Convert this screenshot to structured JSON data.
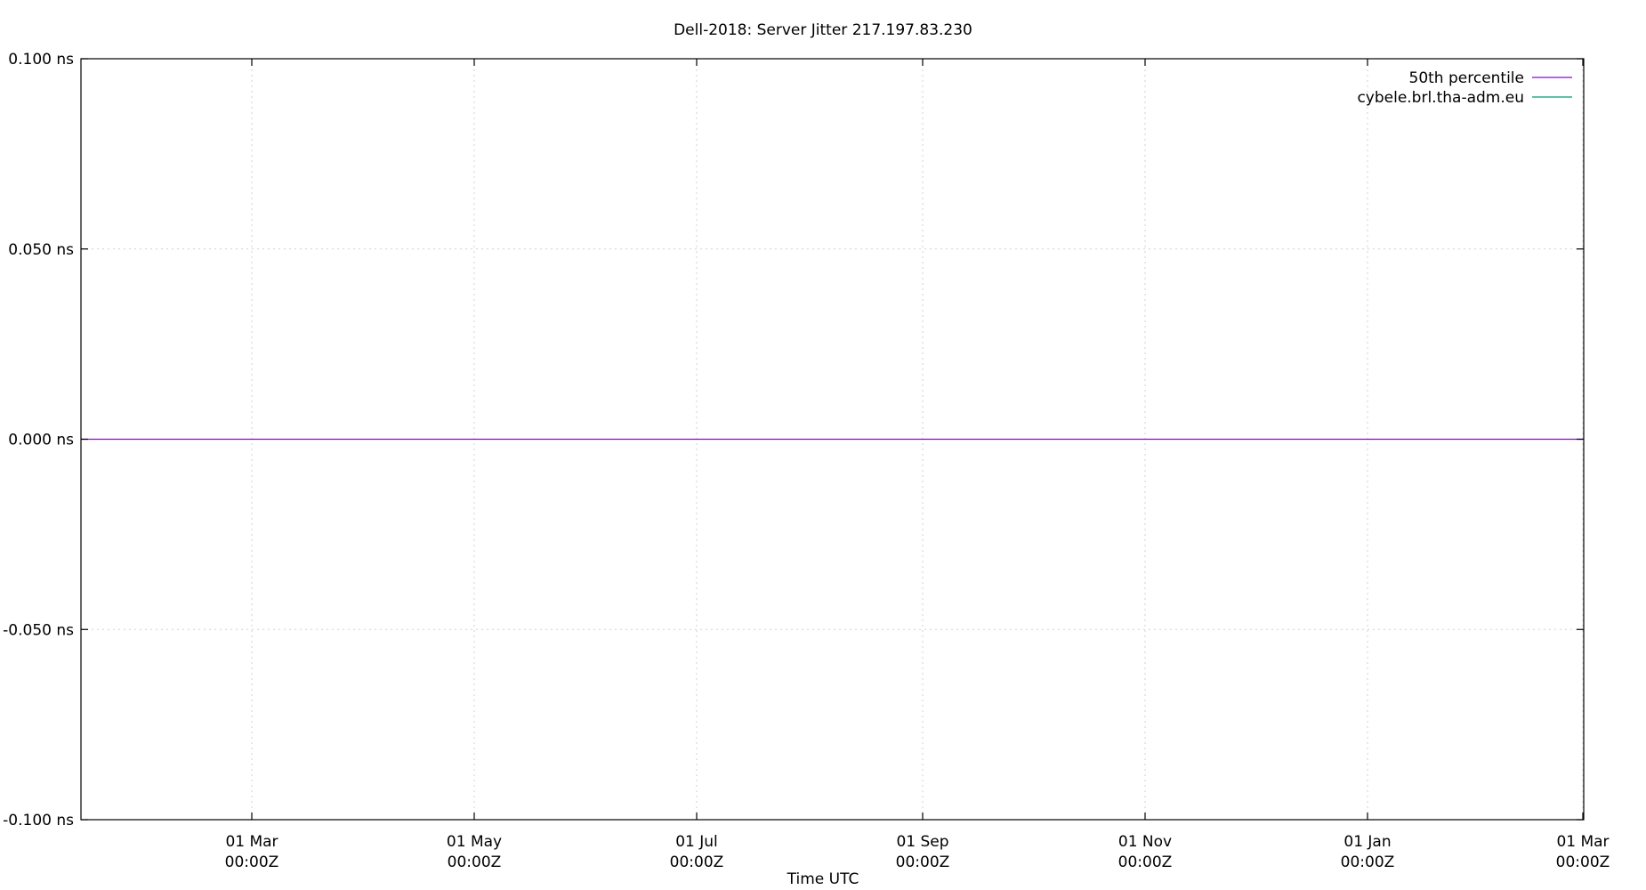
{
  "chart_data": {
    "type": "line",
    "title": "Dell-2018: Server Jitter 217.197.83.230",
    "xlabel": "Time UTC",
    "ylabel": "",
    "ylim": [
      -0.1,
      0.1
    ],
    "y_ticks": [
      {
        "value": 0.1,
        "label": "0.100 ns"
      },
      {
        "value": 0.05,
        "label": "0.050 ns"
      },
      {
        "value": 0.0,
        "label": "0.000 ns"
      },
      {
        "value": -0.05,
        "label": "-0.050 ns"
      },
      {
        "value": -0.1,
        "label": "-0.100 ns"
      }
    ],
    "x_ticks": [
      {
        "line1": "01 Mar",
        "line2": "00:00Z"
      },
      {
        "line1": "01 May",
        "line2": "00:00Z"
      },
      {
        "line1": "01 Jul",
        "line2": "00:00Z"
      },
      {
        "line1": "01 Sep",
        "line2": "00:00Z"
      },
      {
        "line1": "01 Nov",
        "line2": "00:00Z"
      },
      {
        "line1": "01 Jan",
        "line2": "00:00Z"
      },
      {
        "line1": "01 Mar",
        "line2": "00:00Z"
      }
    ],
    "grid": true,
    "legend_position": "top-right",
    "series": [
      {
        "name": "50th percentile",
        "color": "#9400d3",
        "values": [
          0.0,
          0.0
        ]
      },
      {
        "name": "cybele.brl.tha-adm.eu",
        "color": "#009e73",
        "values": []
      }
    ]
  }
}
